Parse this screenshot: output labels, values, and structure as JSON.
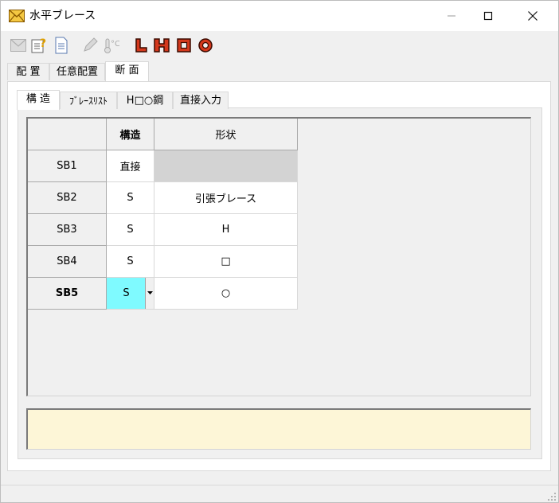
{
  "window": {
    "title": "水平ブレース"
  },
  "toolbar": {
    "icons": [
      "envelope-icon",
      "help-properties-icon",
      "document-icon",
      "pencil-icon",
      "temperature-icon",
      "l-steel-icon",
      "h-steel-icon",
      "square-tube-icon",
      "round-tube-icon"
    ]
  },
  "outer_tabs": [
    {
      "label": "配 置"
    },
    {
      "label": "任意配置"
    },
    {
      "label": "断 面",
      "active": true
    }
  ],
  "inner_tabs": [
    {
      "label": "構 造",
      "active": true
    },
    {
      "label": "ﾌﾞﾚｰｽﾘｽﾄ"
    },
    {
      "label": "H□○鋼"
    },
    {
      "label": "直接入力"
    }
  ],
  "grid": {
    "columns": [
      "",
      "構造",
      "形状"
    ],
    "rows": [
      {
        "name": "SB1",
        "structure": "直接",
        "shape": ""
      },
      {
        "name": "SB2",
        "structure": "S",
        "shape": "引張ブレース"
      },
      {
        "name": "SB3",
        "structure": "S",
        "shape": "H"
      },
      {
        "name": "SB4",
        "structure": "S",
        "shape": "□"
      },
      {
        "name": "SB5",
        "structure": "S",
        "shape": "○",
        "selected": true
      }
    ]
  },
  "colors": {
    "selected_cell": "#7ffaff",
    "disabled_cell": "#d3d3d3",
    "message_bg": "#fdf6d7"
  }
}
